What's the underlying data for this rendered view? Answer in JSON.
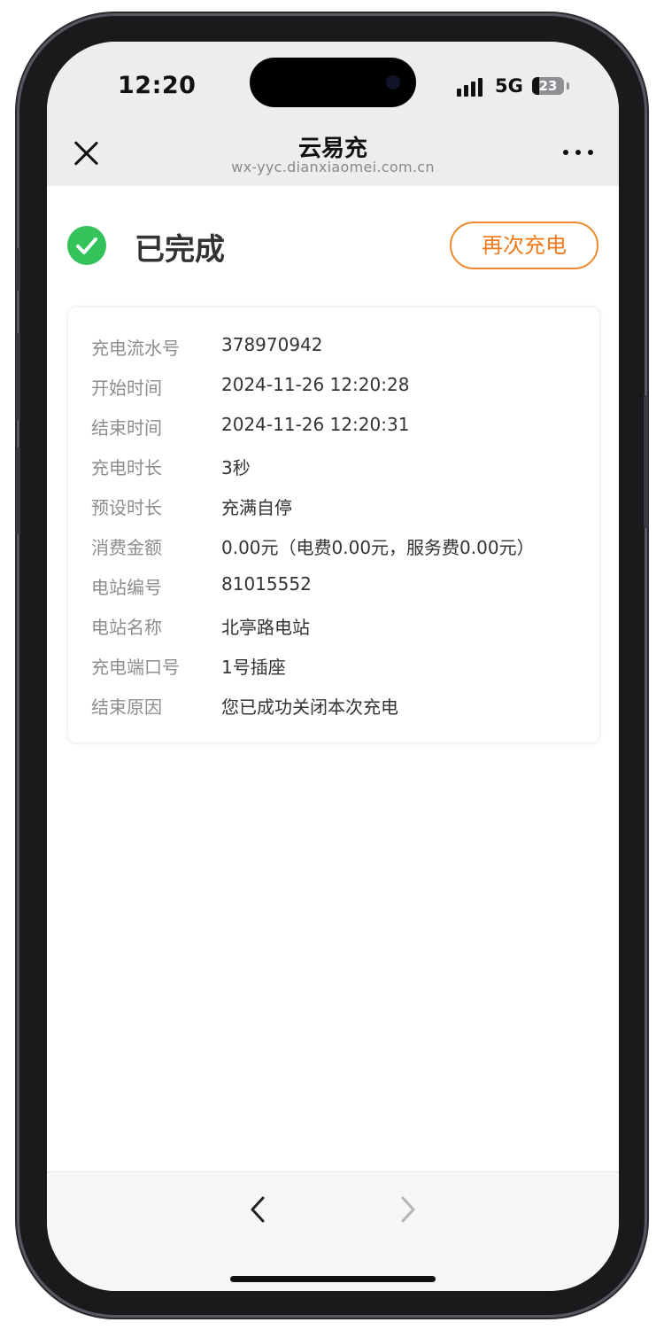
{
  "status_bar": {
    "time": "12:20",
    "network": "5G",
    "battery": "23",
    "battery_level": 0.23,
    "icons": [
      "signal-bars-icon",
      "battery-icon"
    ]
  },
  "nav": {
    "title": "云易充",
    "url": "wx-yyc.dianxiaomei.com.cn",
    "icons": [
      "close-icon",
      "more-dots-icon"
    ]
  },
  "status": {
    "icon": "check-circle-icon",
    "title": "已完成",
    "recharge_label": "再次充电",
    "colors": {
      "success": "#34c35a",
      "accent": "#f07a1c"
    }
  },
  "details": {
    "rows": [
      {
        "label": "充电流水号",
        "value": "378970942"
      },
      {
        "label": "开始时间",
        "value": "2024-11-26 12:20:28"
      },
      {
        "label": "结束时间",
        "value": "2024-11-26 12:20:31"
      },
      {
        "label": "充电时长",
        "value": "3秒"
      },
      {
        "label": "预设时长",
        "value": "充满自停"
      },
      {
        "label": "消费金额",
        "value": "0.00元（电费0.00元，服务费0.00元）"
      },
      {
        "label": "电站编号",
        "value": "81015552"
      },
      {
        "label": "电站名称",
        "value": "北亭路电站"
      },
      {
        "label": "充电端口号",
        "value": "1号插座"
      },
      {
        "label": "结束原因",
        "value": "您已成功关闭本次充电"
      }
    ]
  },
  "bottom_nav": {
    "icons": [
      "chevron-left-icon",
      "chevron-right-icon"
    ]
  }
}
